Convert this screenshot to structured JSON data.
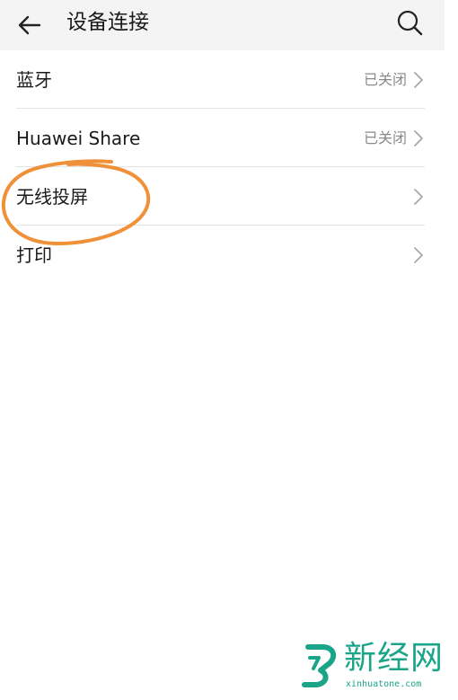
{
  "header": {
    "title": "设备连接",
    "back_icon": "arrow-left-icon",
    "search_icon": "search-icon"
  },
  "rows": [
    {
      "label": "蓝牙",
      "status": "已关闭"
    },
    {
      "label": "Huawei Share",
      "status": "已关闭"
    },
    {
      "label": "无线投屏",
      "status": ""
    },
    {
      "label": "打印",
      "status": ""
    }
  ],
  "annotation": {
    "color": "#f0913a",
    "target": "无线投屏"
  },
  "watermark": {
    "name": "新经网",
    "domain": "xinhuatone.com",
    "color": "#1aa588"
  }
}
